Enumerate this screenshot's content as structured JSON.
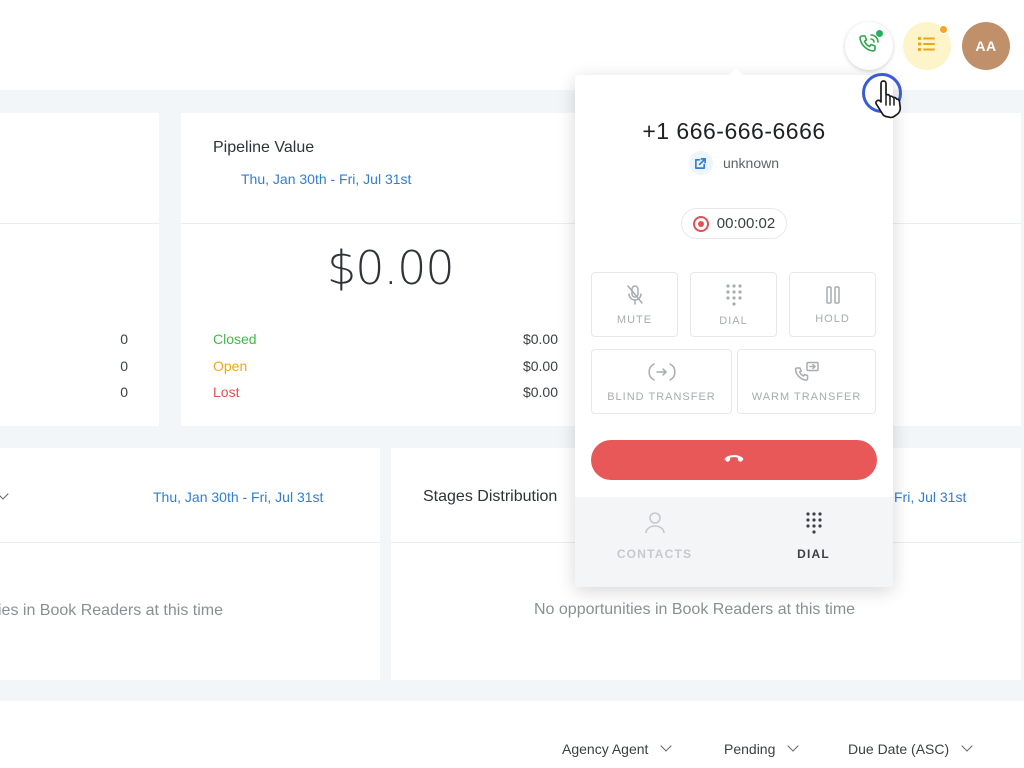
{
  "topbar": {
    "avatar_initials": "AA",
    "phone_icon": "phone-call-icon",
    "tasks_icon": "list-icon"
  },
  "pipeline_card": {
    "title": "Pipeline Value",
    "date_range": "Thu, Jan 30th - Fri, Jul 31st",
    "amount": "$0.00",
    "rows": [
      {
        "label": "Closed",
        "value": "$0.00",
        "color": "#3fba4a"
      },
      {
        "label": "Open",
        "value": "$0.00",
        "color": "#f2a51c"
      },
      {
        "label": "Lost",
        "value": "$0.00",
        "color": "#e05252"
      }
    ]
  },
  "left_card": {
    "counts": [
      "0",
      "0",
      "0"
    ]
  },
  "opportunities_card": {
    "date_range": "Thu, Jan 30th - Fri, Jul 31st",
    "empty_message": "ies in Book Readers at this time"
  },
  "stages_card": {
    "title": "Stages Distribution",
    "date_range": "Fri, Jul 31st",
    "empty_message": "No opportunities in Book Readers at this time"
  },
  "filters": {
    "agent": "Agency Agent",
    "status": "Pending",
    "sort": "Due Date (ASC)"
  },
  "dialer": {
    "phone_number": "+1 666-666-6666",
    "caller_name": "unknown",
    "timer": "00:00:02",
    "controls": {
      "mute": "MUTE",
      "dial": "DIAL",
      "hold": "HOLD",
      "blind_transfer": "BLIND TRANSFER",
      "warm_transfer": "WARM TRANSFER"
    },
    "footer": {
      "contacts": "CONTACTS",
      "dial": "DIAL"
    }
  },
  "colors": {
    "accent_blue": "#2f7fd1",
    "hangup_red": "#e85858",
    "online_green": "#27ae60"
  }
}
